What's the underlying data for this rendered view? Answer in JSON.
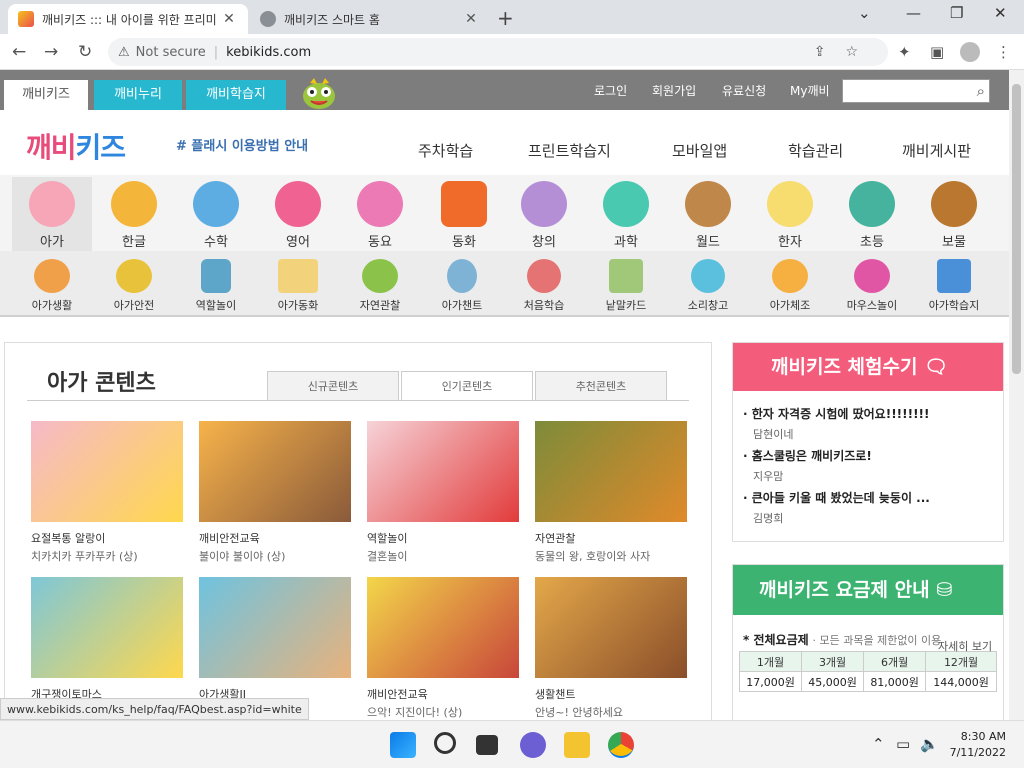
{
  "browser": {
    "tabs": [
      {
        "title": "깨비키즈 ::: 내 아이를 위한 프리미",
        "active": true
      },
      {
        "title": "깨비키즈 스마트 홈",
        "active": false
      }
    ],
    "new_tab": "+",
    "window_controls": {
      "chevron": "⌄",
      "minimize": "—",
      "restore": "❐",
      "close": "✕"
    },
    "nav": {
      "back": "←",
      "forward": "→",
      "reload": "↻"
    },
    "address": {
      "security": "Not secure",
      "url": "kebikids.com"
    },
    "omnibox_icons": [
      "share-icon",
      "star-icon"
    ],
    "toolbar_icons": [
      "extensions-icon",
      "sidebar-icon",
      "profile-icon",
      "menu-icon"
    ]
  },
  "site": {
    "top_tabs": [
      "깨비키즈",
      "깨비누리",
      "깨비학습지"
    ],
    "top_links": [
      "로그인",
      "회원가입",
      "유료신청",
      "My깨비"
    ],
    "search": {
      "placeholder": ""
    },
    "logo": {
      "a": "깨비",
      "b": "키즈"
    },
    "flash_link": "# 플래시 이용방법 안내",
    "main_nav": [
      "주차학습",
      "프린트학습지",
      "모바일앱",
      "학습관리",
      "깨비게시판"
    ],
    "categories_1": [
      "아가",
      "한글",
      "수학",
      "영어",
      "동요",
      "동화",
      "창의",
      "과학",
      "월드",
      "한자",
      "초등",
      "보물"
    ],
    "categories_2": [
      "아가생활",
      "아가안전",
      "역할놀이",
      "아가동화",
      "자연관찰",
      "아가챈트",
      "처음학습",
      "낱말카드",
      "소리창고",
      "아가체조",
      "마우스놀이",
      "아가학습지"
    ],
    "content": {
      "title": "아가 콘텐츠",
      "tabs": [
        "신규콘텐츠",
        "인기콘텐츠",
        "추천콘텐츠"
      ],
      "items": [
        {
          "cat": "요절복통 알랑이",
          "title": "치카치카 푸카푸카 (상)",
          "colors": [
            "#f6b9c9",
            "#ffd84d"
          ]
        },
        {
          "cat": "깨비안전교육",
          "title": "불이야 불이야 (상)",
          "colors": [
            "#f7b34a",
            "#8a5a3a"
          ]
        },
        {
          "cat": "역할놀이",
          "title": "결혼놀이",
          "colors": [
            "#f6d3d8",
            "#e23b3b"
          ]
        },
        {
          "cat": "자연관찰",
          "title": "동물의 왕, 호랑이와 사자",
          "colors": [
            "#7d8b3a",
            "#e08a2a"
          ]
        },
        {
          "cat": "개구쟁이토마스",
          "title": "",
          "colors": [
            "#7ec7d8",
            "#ffd84d"
          ]
        },
        {
          "cat": "아가생활II",
          "title": "",
          "colors": [
            "#6ec3e0",
            "#e8b27c"
          ]
        },
        {
          "cat": "깨비안전교육",
          "title": "으악! 지진이다! (상)",
          "colors": [
            "#f3d64a",
            "#c8463a"
          ]
        },
        {
          "cat": "생활챈트",
          "title": "안녕~! 안녕하세요",
          "colors": [
            "#e4a84a",
            "#8a4e2a"
          ]
        }
      ]
    },
    "review_box": {
      "title": "깨비키즈 체험수기",
      "items": [
        {
          "q": "한자 자격증 시험에 땄어요!!!!!!!!",
          "who": "담현이네"
        },
        {
          "q": "홈스쿨링은 깨비키즈로!",
          "who": "지우맘"
        },
        {
          "q": "큰아들 키울 때 봤었는데 늦둥이 ...",
          "who": "김명희"
        }
      ]
    },
    "price_box": {
      "title": "깨비키즈 요금제 안내",
      "label": "전체요금제",
      "desc": "모든 과목을 제한없이 이용",
      "headers": [
        "1개월",
        "3개월",
        "6개월",
        "12개월"
      ],
      "prices": [
        "17,000원",
        "45,000원",
        "81,000원",
        "144,000원"
      ],
      "more": "자세히 보기"
    }
  },
  "status_url": "www.kebikids.com/ks_help/faq/FAQbest.asp?id=white",
  "taskbar": {
    "time": "8:30 AM",
    "date": "7/11/2022"
  },
  "colors": {
    "pink": "#f45c7b",
    "green": "#3cb371",
    "cyan": "#27b8d0"
  }
}
